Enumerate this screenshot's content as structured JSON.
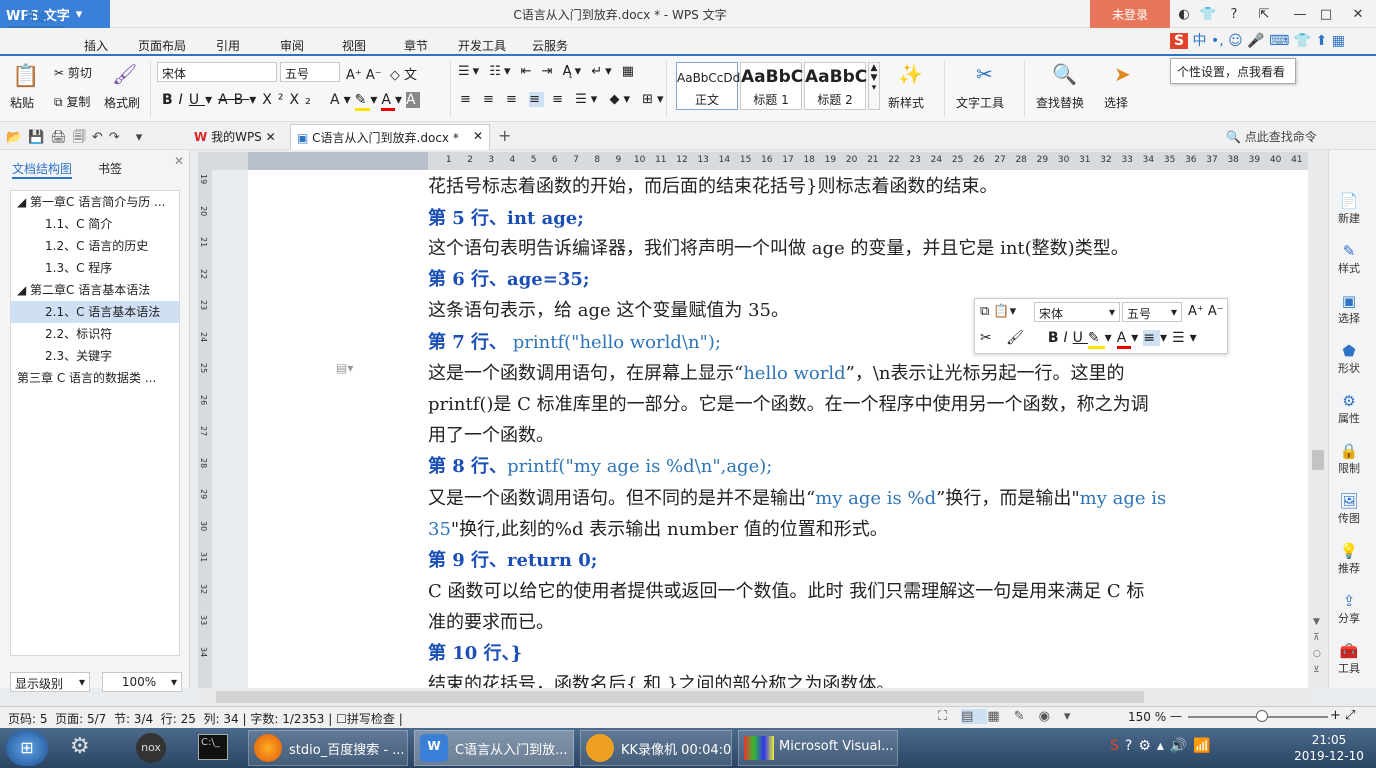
{
  "app": {
    "logo": "WPS 文字",
    "title": "C语言从入门到放弃.docx * - WPS 文字",
    "login": "未登录"
  },
  "tabs": [
    "开始",
    "插入",
    "页面布局",
    "引用",
    "审阅",
    "视图",
    "章节",
    "开发工具",
    "云服务"
  ],
  "ribbon": {
    "paste": "粘贴",
    "cut": "剪切",
    "copy": "复制",
    "format_painter": "格式刷",
    "font": "宋体",
    "size": "五号",
    "styles": [
      {
        "preview": "AaBbCcDd",
        "name": "正文"
      },
      {
        "preview": "AaBbC",
        "name": "标题 1"
      },
      {
        "preview": "AaBbC",
        "name": "标题 2"
      }
    ],
    "new_style": "新样式",
    "text_tools": "文字工具",
    "find_replace": "查找替换",
    "select": "选择"
  },
  "tooltip": "个性设置，点我看看",
  "doctabs": {
    "home": "我的WPS",
    "doc": "C语言从入门到放弃.docx *",
    "search": "点此查找命令"
  },
  "nav": {
    "tab_outline": "文档结构图",
    "tab_bookmark": "书签",
    "items": [
      {
        "label": "第一章C 语言简介与历 ...",
        "level": 0
      },
      {
        "label": "1.1、C 简介",
        "level": 1
      },
      {
        "label": "1.2、C 语言的历史",
        "level": 1
      },
      {
        "label": "1.3、C 程序",
        "level": 1
      },
      {
        "label": "第二章C 语言基本语法",
        "level": 0
      },
      {
        "label": "2.1、C 语言基本语法",
        "level": 1
      },
      {
        "label": "2.2、标识符",
        "level": 1
      },
      {
        "label": "2.3、关键字",
        "level": 1
      },
      {
        "label": "第三章 C 语言的数据类 ...",
        "level": 0
      }
    ],
    "level_select": "显示级别",
    "zoom_select": "100%"
  },
  "ruler_numbers": [
    "8",
    "7",
    "6",
    "5",
    "4",
    "3",
    "2",
    "1",
    "",
    "1",
    "2",
    "3",
    "4",
    "5",
    "6",
    "7",
    "8",
    "9",
    "10",
    "11",
    "12",
    "13",
    "14",
    "15",
    "16",
    "17",
    "18",
    "19",
    "20",
    "21",
    "22",
    "23",
    "24",
    "25",
    "26",
    "27",
    "28",
    "29",
    "30",
    "31",
    "32",
    "33",
    "34",
    "35",
    "36",
    "37",
    "38",
    "39",
    "40",
    "41"
  ],
  "vruler_numbers": [
    "19",
    "20",
    "21",
    "22",
    "23",
    "24",
    "25",
    "26",
    "27",
    "28",
    "29",
    "30",
    "31",
    "32",
    "33",
    "34"
  ],
  "doc": {
    "l1": "花括号标志着函数的开始，而后面的结束花括号}则标志着函数的结束。",
    "l2": "第 5 行、int age;",
    "l3": "这个语句表明告诉编译器，我们将声明一个叫做 age 的变量，并且它是 int(整数)类型。",
    "l4": "第 6 行、age=35;",
    "l5": "这条语句表示，给 age 这个变量赋值为 35。",
    "l6a": "第 7 行、",
    "l6b": " printf(\"hello world\\n\");",
    "l7a": "这是一个函数调用语句，在屏幕上显示“",
    "l7b": "hello world",
    "l7c": "”，\\n表示让光标另起一行。这里的",
    "l8": "printf()是 C 标准库里的一部分。它是一个函数。在一个程序中使用另一个函数，称之为调",
    "l9": "用了一个函数。",
    "l10a": "第 8 行、",
    "l10b": "printf(\"my age is %d\\n\",age);",
    "l11a": "又是一个函数调用语句。但不同的是并不是输出“",
    "l11b": "my age is %d",
    "l11c": "”换行，而是输出\"",
    "l11d": "my age is",
    "l12a": "35",
    "l12b": "\"换行,此刻的%d 表示输出 number 值的位置和形式。",
    "l13": "第 9 行、return 0;",
    "l14": "C 函数可以给它的使用者提供或返回一个数值。此时 我们只需理解这一句是用来满足 C 标",
    "l15": "准的要求而已。",
    "l16": "第 10 行、}",
    "l17": "结束的花括号，函数名后{ 和 }之间的部分称之为函数体。"
  },
  "floatbar": {
    "font": "宋体",
    "size": "五号"
  },
  "rightpanel": [
    "新建",
    "样式",
    "选择",
    "形状",
    "属性",
    "限制",
    "传图",
    "推荐",
    "分享",
    "工具"
  ],
  "status": {
    "page": "页码: 5",
    "pages": "页面: 5/7",
    "section": "节: 3/4",
    "row": "行: 25",
    "col": "列: 34",
    "words": "字数: 1/2353",
    "spell": "拼写检查",
    "zoom": "150 %"
  },
  "taskbar": {
    "items": [
      "stdio_百度搜索 - ...",
      "C语言从入门到放...",
      "KK录像机 00:04:00",
      "Microsoft Visual..."
    ],
    "time": "21:05",
    "date": "2019-12-10"
  },
  "colors": {
    "accent": "#2e74c5",
    "heading": "#1a4fb5",
    "code": "#2e75b6",
    "login": "#e8765a"
  }
}
